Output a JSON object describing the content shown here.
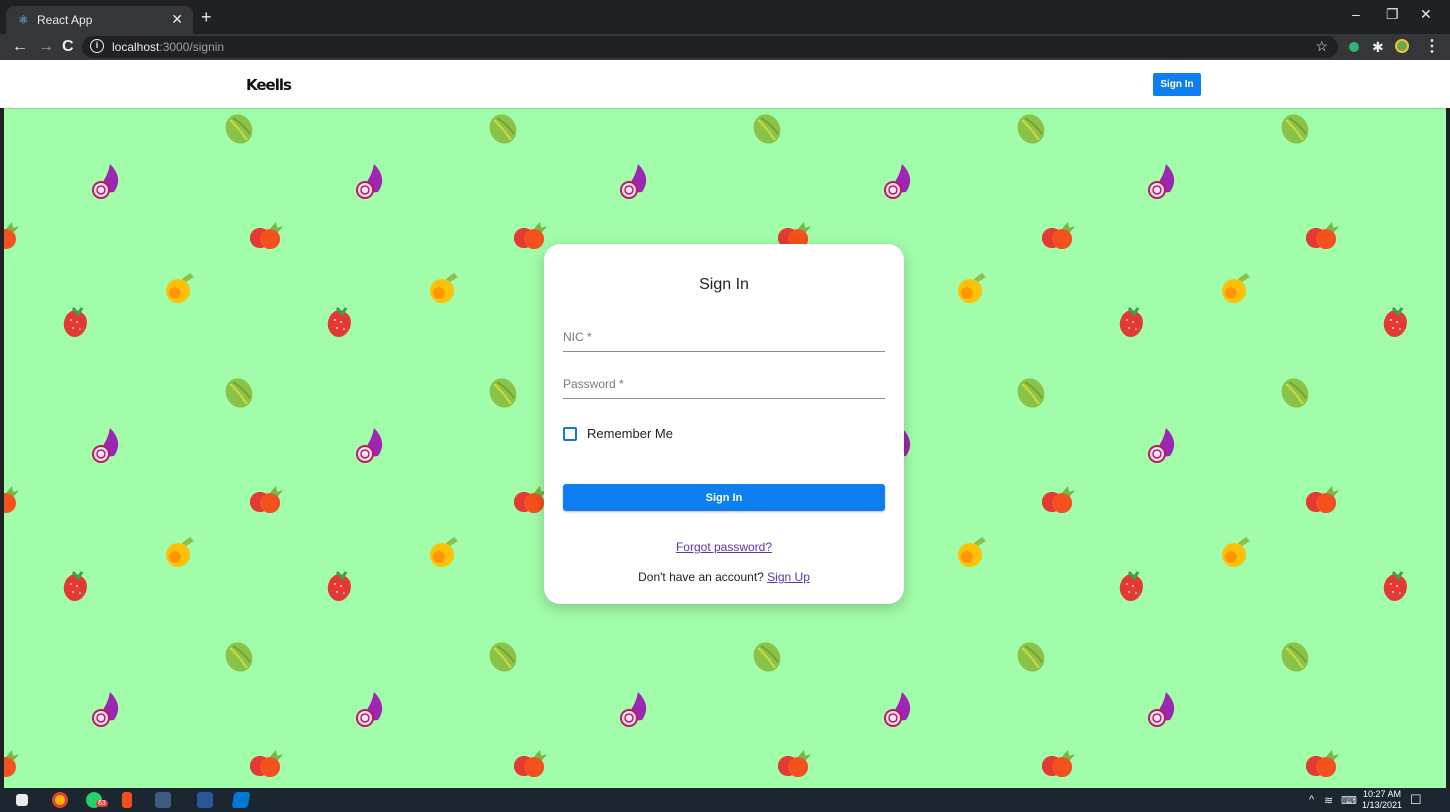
{
  "browser": {
    "tab_title": "React App",
    "url_host": "localhost",
    "url_rest": ":3000/signin"
  },
  "navbar": {
    "logo": "Keells",
    "signin_label": "Sign In"
  },
  "signin_form": {
    "title": "Sign In",
    "nic_label": "NIC *",
    "password_label": "Password *",
    "remember_label": "Remember Me",
    "remember_checked": false,
    "submit_label": "Sign In",
    "forgot_label": "Forgot password?",
    "signup_prompt": "Don't have an account?",
    "signup_link": "Sign Up"
  },
  "background": {
    "color": "#a1fdaa",
    "items": [
      "lettuce",
      "onion",
      "tomato",
      "orange",
      "strawberry"
    ]
  },
  "taskbar": {
    "time": "10:27 AM",
    "date": "1/13/2021",
    "badge_count": "63"
  },
  "colors": {
    "primary": "#0d7ff0",
    "link": "#5e35b1"
  }
}
